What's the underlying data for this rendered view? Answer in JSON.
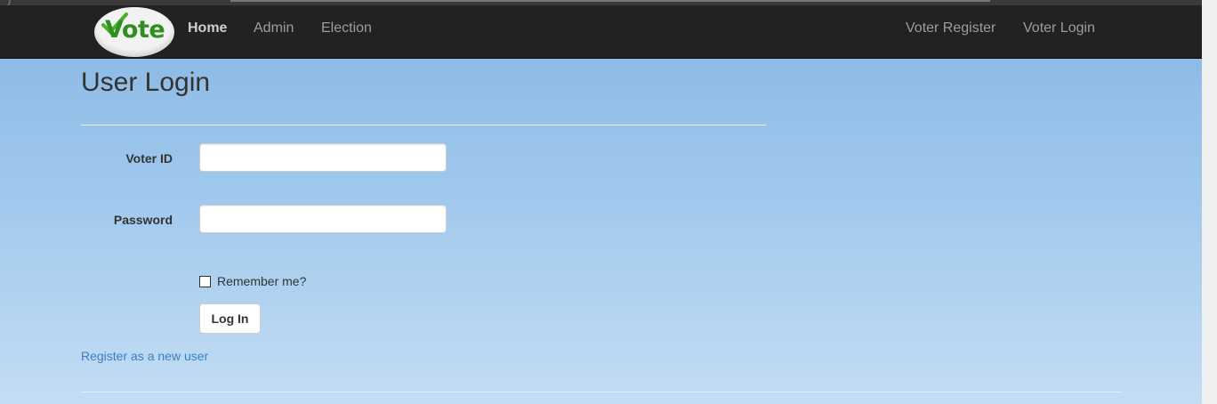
{
  "brand": {
    "logo_text": "Vote"
  },
  "nav": {
    "left": [
      {
        "label": "Home",
        "active": true
      },
      {
        "label": "Admin",
        "active": false
      },
      {
        "label": "Election",
        "active": false
      }
    ],
    "right": [
      {
        "label": "Voter Register"
      },
      {
        "label": "Voter Login"
      }
    ]
  },
  "page": {
    "title": "User Login"
  },
  "form": {
    "voter_id_label": "Voter ID",
    "voter_id_value": "",
    "password_label": "Password",
    "password_value": "",
    "remember_label": "Remember me?",
    "remember_checked": false,
    "submit_label": "Log In"
  },
  "links": {
    "register": "Register as a new user"
  },
  "colors": {
    "navbar": "#222222",
    "link": "#3a7fc4",
    "logo_green": "#2f8f1f"
  }
}
